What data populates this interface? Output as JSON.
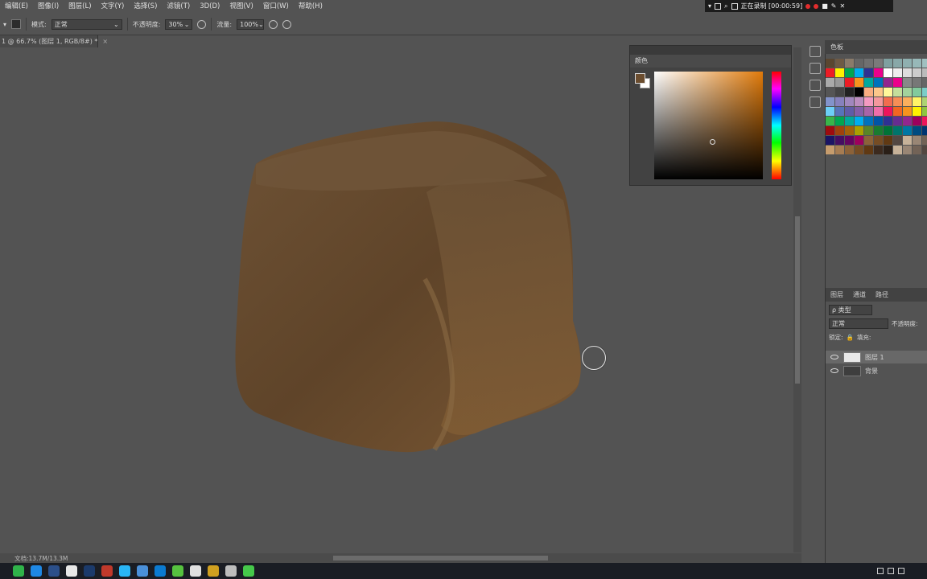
{
  "menubar": {
    "items": [
      "编辑(E)",
      "图像(I)",
      "图层(L)",
      "文字(Y)",
      "选择(S)",
      "滤镜(T)",
      "3D(D)",
      "视图(V)",
      "窗口(W)",
      "帮助(H)"
    ]
  },
  "recorder": {
    "label": "正在录制 [00:00:59]"
  },
  "options": {
    "mode_label": "模式:",
    "mode_value": "正常",
    "opacity_label": "不透明度:",
    "opacity_value": "30%",
    "flow_label": "流量:",
    "flow_value": "100%"
  },
  "document": {
    "tab_title": "1 @ 66.7% (图层 1, RGB/8#) *",
    "status": "文档:13.7M/13.3M"
  },
  "color_panel": {
    "title": "颜色",
    "foreground": "#6b4d2f",
    "background": "#ffffff"
  },
  "swatches": {
    "title": "色板",
    "colors": [
      "#5a4630",
      "#6e5a45",
      "#8a7b6a",
      "#666",
      "#707070",
      "#7a7a7a",
      "#7fa0a0",
      "#88a8a8",
      "#8fb0b0",
      "#97b8b8",
      "#a0c0c0",
      "#ee1c25",
      "#fff200",
      "#00a651",
      "#00aeef",
      "#2e3192",
      "#ec008c",
      "#fff",
      "#eee",
      "#ddd",
      "#ccc",
      "#bbb",
      "#aaa",
      "#999",
      "#ed1c24",
      "#f7941d",
      "#00a99d",
      "#0072bc",
      "#92278f",
      "#ec008c",
      "#888",
      "#777",
      "#666",
      "#555",
      "#444",
      "#222",
      "#000",
      "#f9ad81",
      "#fdc68a",
      "#fff79a",
      "#c4df9b",
      "#a2d39c",
      "#82ca9d",
      "#7bcdc8",
      "#8393ca",
      "#8781bd",
      "#a187be",
      "#bc8dbf",
      "#f49ac1",
      "#f5989d",
      "#f26c4f",
      "#f68e56",
      "#fbaf5d",
      "#fff467",
      "#acd373",
      "#6dcff6",
      "#5674b9",
      "#605ca8",
      "#855fa8",
      "#a864a8",
      "#f06eaa",
      "#ed145b",
      "#f26522",
      "#f7941d",
      "#fff200",
      "#8dc63f",
      "#39b54a",
      "#00a651",
      "#00a99d",
      "#00aeef",
      "#0072bc",
      "#0054a6",
      "#2e3192",
      "#662d91",
      "#92278f",
      "#9e005d",
      "#ed145b",
      "#9e0b0f",
      "#a0410d",
      "#a3620a",
      "#aba000",
      "#598527",
      "#197b30",
      "#007236",
      "#00746b",
      "#0076a3",
      "#004b80",
      "#003471",
      "#1b1464",
      "#440e62",
      "#630460",
      "#9e005d",
      "#8c6239",
      "#754c24",
      "#603913",
      "#534741",
      "#c7b299",
      "#998675",
      "#736357",
      "#c69c6d",
      "#a67c52",
      "#8c6239",
      "#754c24",
      "#603913",
      "#3c2a1e",
      "#2a1f17",
      "#c7b299",
      "#998675",
      "#736357",
      "#534741"
    ]
  },
  "layers_panel": {
    "tabs": [
      "图层",
      "通道",
      "路径"
    ],
    "filter_label": "ρ 类型",
    "blend_mode": "正常",
    "opacity_label": "不透明度:",
    "lock_label": "锁定:",
    "fill_label": "填充:",
    "layers": [
      {
        "name": "图层 1",
        "visible": true,
        "selected": true
      },
      {
        "name": "背景",
        "visible": true,
        "selected": false
      }
    ]
  },
  "taskbar": {
    "apps": [
      "#2fb34a",
      "#1e88e5",
      "#2b4f8a",
      "#e8e8e8",
      "#1b3a6b",
      "#c0392b",
      "#29b6f6",
      "#4a90d9",
      "#0b7bd1",
      "#56c23f",
      "#e0e0e0",
      "#d0a020",
      "#bdbdbd",
      "#45c84a"
    ]
  }
}
